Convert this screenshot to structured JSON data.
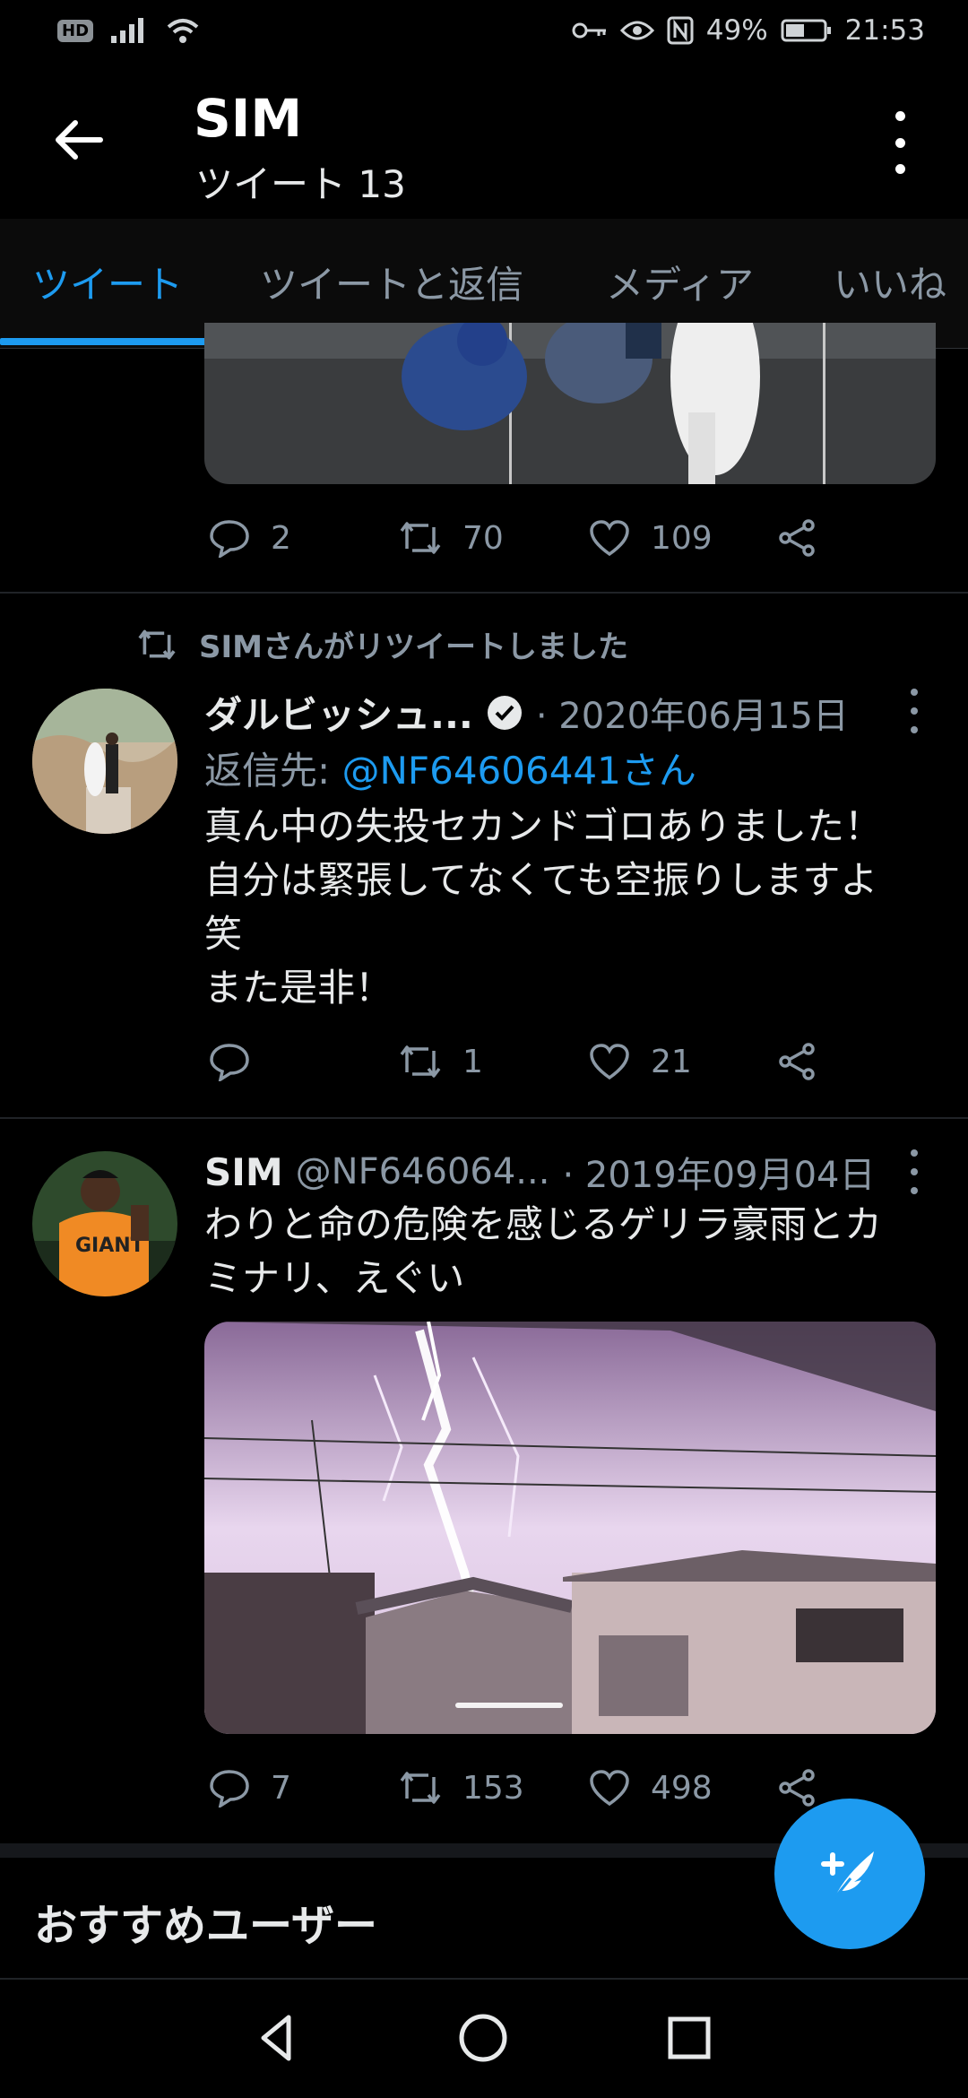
{
  "status_bar": {
    "hd": "HD",
    "battery_percent": "49%",
    "time": "21:53"
  },
  "header": {
    "title": "SIM",
    "subtitle": "ツイート 13"
  },
  "tabs": [
    {
      "label": "ツイート",
      "active": true
    },
    {
      "label": "ツイートと返信",
      "active": false
    },
    {
      "label": "メディア",
      "active": false
    },
    {
      "label": "いいね",
      "active": false
    }
  ],
  "tweet1": {
    "replies": "2",
    "retweets": "70",
    "likes": "109"
  },
  "tweet2": {
    "retweet_notice": "SIMさんがリツイートしました",
    "name": "ダルビッシュ...",
    "date": "· 2020年06月15日",
    "reply_to_prefix": "返信先: ",
    "reply_to_handle": "@NF64606441さん",
    "lines": [
      "真ん中の失投セカンドゴロありました！",
      "自分は緊張してなくても空振りしますよ",
      "笑",
      "また是非！"
    ],
    "replies": "",
    "retweets": "1",
    "likes": "21"
  },
  "tweet3": {
    "name": "SIM",
    "handle": "@NF646064...",
    "date": "· 2019年09月04日",
    "lines": [
      "わりと命の危険を感じるゲリラ豪雨とカ",
      "ミナリ、えぐい"
    ],
    "replies": "7",
    "retweets": "153",
    "likes": "498"
  },
  "recommended": {
    "title": "おすすめユーザー"
  },
  "colors": {
    "accent": "#1d9bf0",
    "background": "#000000",
    "muted": "#8b98a5"
  }
}
